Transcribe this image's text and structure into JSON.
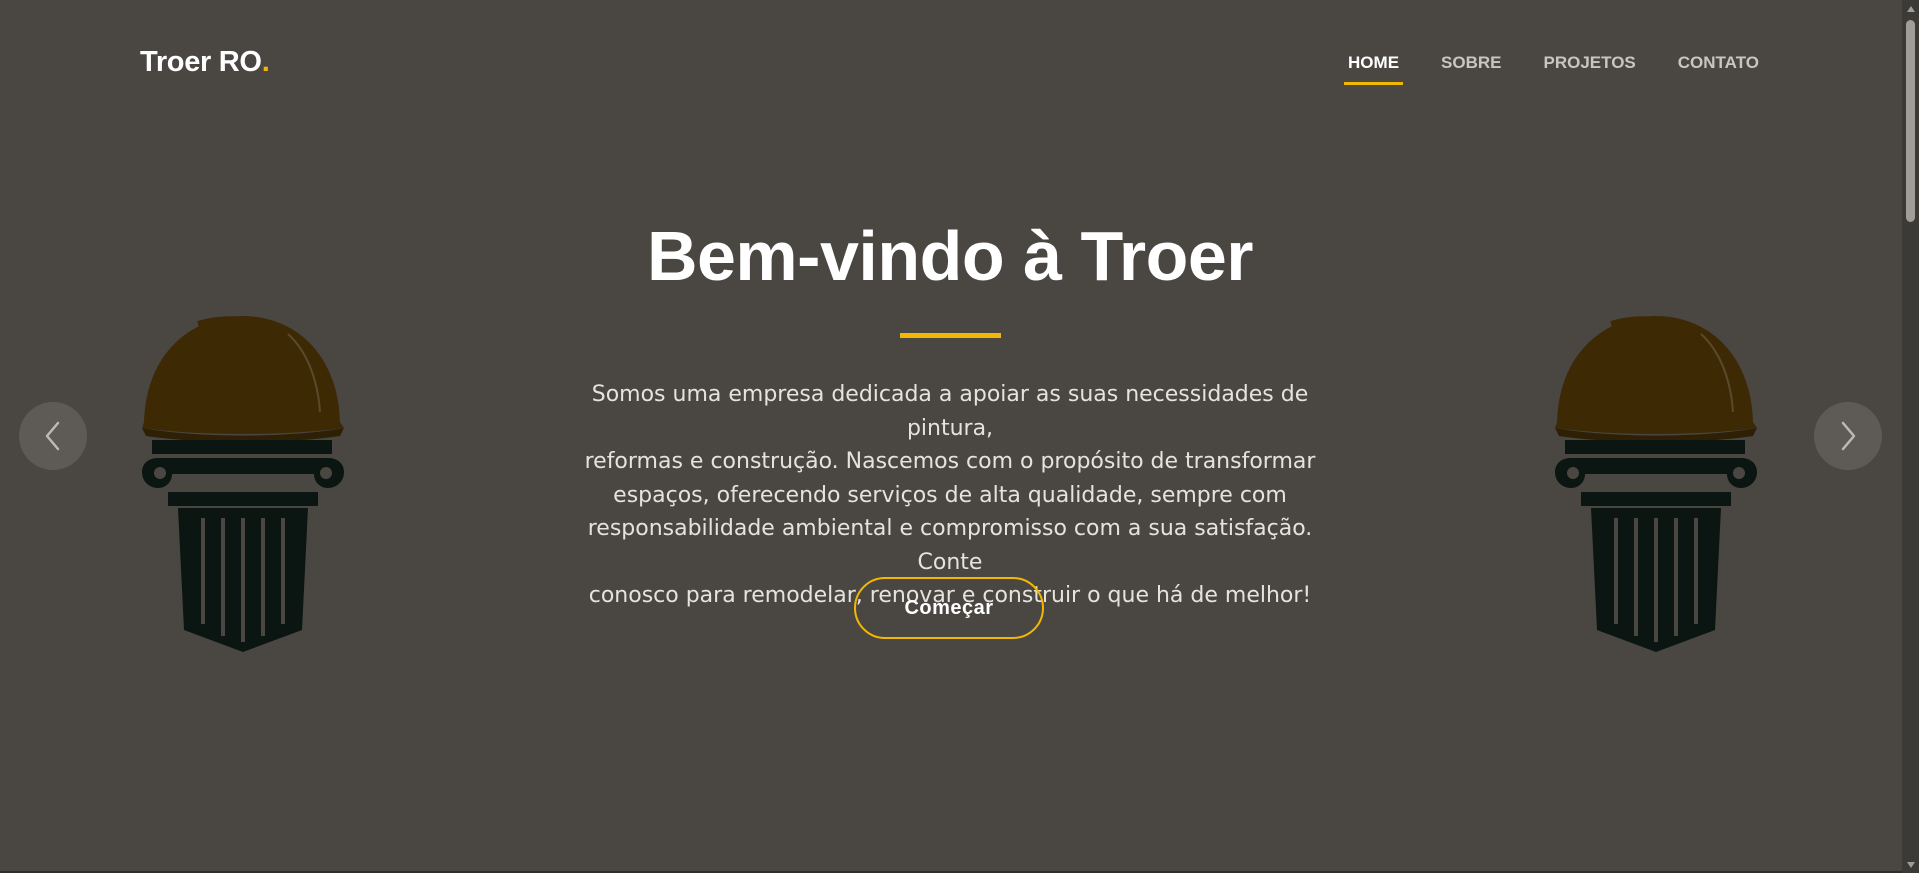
{
  "brand": {
    "name": "Troer RO",
    "dot": ".",
    "accent_color": "#f2b705"
  },
  "nav": {
    "items": [
      {
        "label": "HOME",
        "active": true
      },
      {
        "label": "SOBRE",
        "active": false
      },
      {
        "label": "PROJETOS",
        "active": false
      },
      {
        "label": "CONTATO",
        "active": false
      }
    ]
  },
  "hero": {
    "title": "Bem-vindo à Troer",
    "lines": [
      "Somos uma empresa dedicada a apoiar as suas necessidades de pintura,",
      "reformas e construção. Nascemos com o propósito de transformar",
      "espaços, oferecendo serviços de alta qualidade, sempre com",
      "responsabilidade ambiental e compromisso com a sua satisfação. Conte",
      "conosco para remodelar, renovar e construir o que há de melhor!"
    ],
    "cta_label": "Começar"
  },
  "carousel": {
    "prev_icon": "chevron-left-icon",
    "next_icon": "chevron-right-icon"
  },
  "emblem": {
    "icon": "helmet-column-icon",
    "helmet_color": "#3d2a05",
    "column_color": "#0b1512"
  },
  "colors": {
    "background": "#4a4742",
    "text": "#ffffff"
  }
}
